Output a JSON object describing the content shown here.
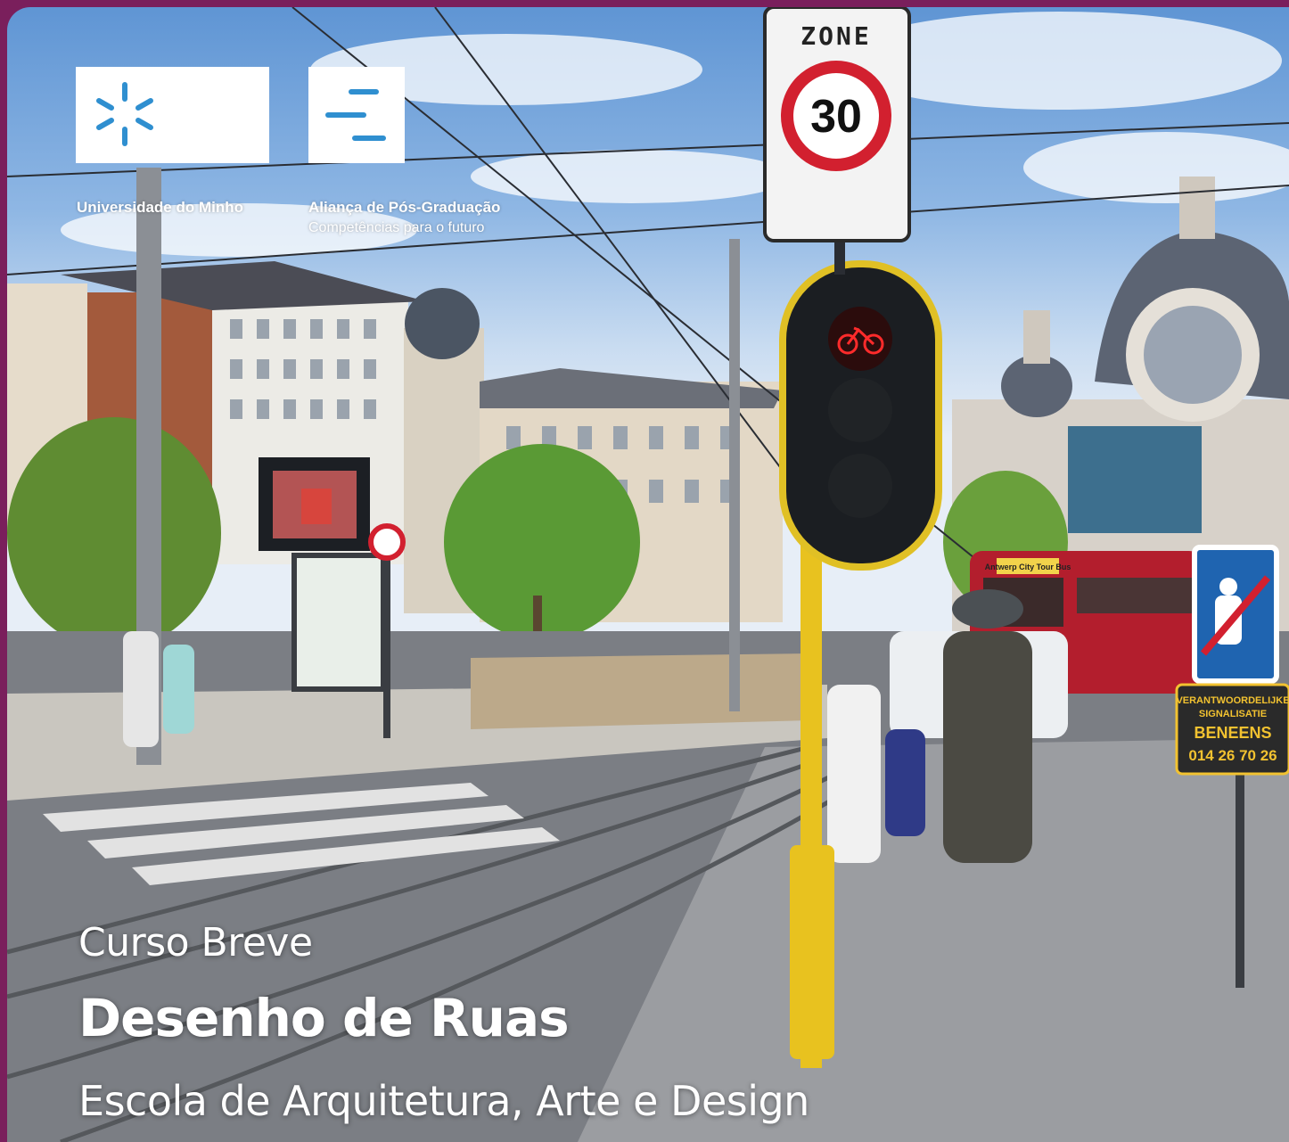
{
  "logos": {
    "uminho": {
      "name": "Universidade do Minho",
      "icon": "uminho-star-icon"
    },
    "apg": {
      "name": "Aliança de Pós-Graduação",
      "tagline": "Competências para o futuro",
      "icon": "apg-lines-icon"
    }
  },
  "headline": {
    "course_type": "Curso Breve",
    "title": "Desenho de Ruas",
    "school": "Escola de Arquitetura, Arte e Design"
  },
  "signs": {
    "zone_label": "ZONE",
    "speed": "30",
    "bus_banner": "Antwerp City Tour Bus",
    "contractor_line1": "VERANTWOORDELIJKE",
    "contractor_line2": "SIGNALISATIE",
    "contractor_name": "BENEENS",
    "contractor_phone": "014 26 70 26"
  },
  "colors": {
    "frame": "#7a1f5c",
    "sky": "#8fb7e4",
    "logo_blue": "#2f8fd0",
    "sign_red": "#d2202f",
    "signal_yellow": "#e8c21f"
  }
}
